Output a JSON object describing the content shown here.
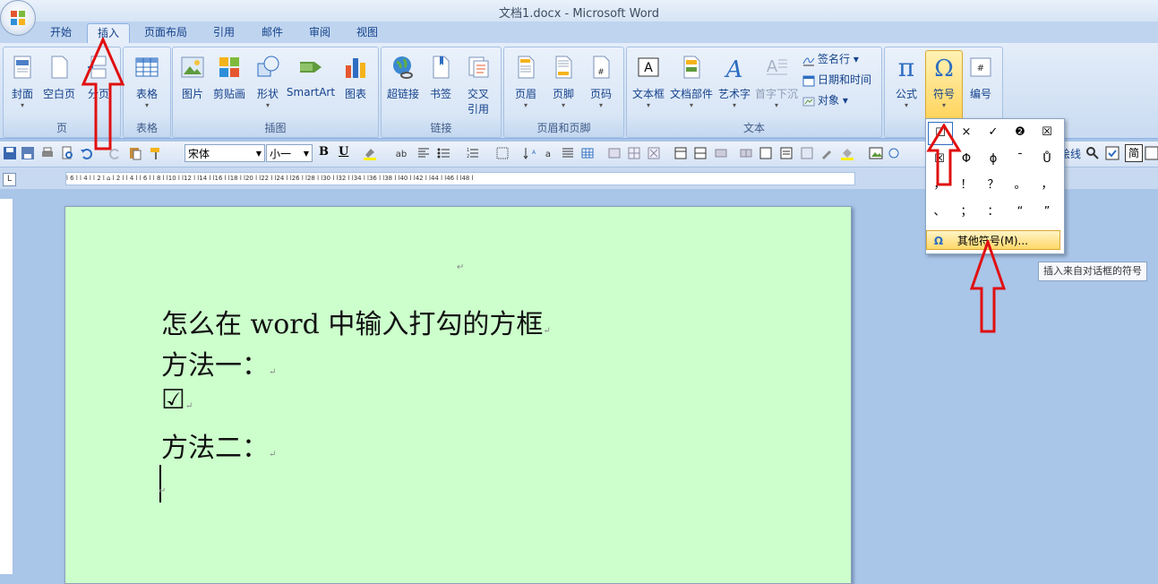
{
  "window": {
    "title": "文档1.docx - Microsoft Word"
  },
  "tabs": [
    "开始",
    "插入",
    "页面布局",
    "引用",
    "邮件",
    "审阅",
    "视图"
  ],
  "active_tab": "插入",
  "ribbon": {
    "groups": {
      "pages": {
        "name": "页",
        "buttons": [
          "封面",
          "空白页",
          "分页"
        ]
      },
      "tables": {
        "name": "表格",
        "buttons": [
          "表格"
        ]
      },
      "illustrations": {
        "name": "插图",
        "buttons": [
          "图片",
          "剪贴画",
          "形状",
          "SmartArt",
          "图表"
        ]
      },
      "links": {
        "name": "链接",
        "buttons": [
          "超链接",
          "书签",
          "交叉",
          "引用"
        ]
      },
      "header_footer": {
        "name": "页眉和页脚",
        "buttons": [
          "页眉",
          "页脚",
          "页码"
        ]
      },
      "text": {
        "name": "文本",
        "buttons": [
          "文本框",
          "文档部件",
          "艺术字",
          "首字下沉"
        ],
        "small": [
          "签名行",
          "日期和时间",
          "对象"
        ]
      },
      "symbols": {
        "buttons": [
          "公式",
          "符号",
          "编号"
        ]
      }
    }
  },
  "toolbar": {
    "font": "宋体",
    "size": "小一",
    "bold": "B",
    "underline": "U",
    "right_text": "绘线",
    "right_char": "简"
  },
  "ruler": {
    "marks": "l 6 l  l 4 l  l 2 l  ⌂  l 2 l  l 4 l  l 6 l  l 8 l  l10 l  l12 l  l14 l  l16 l  l18 l  l20 l  l22 l  l24 l  l26 l  l28 l  l30 l  l32 l  l34 l  l36 l  l38 l  l40 l  l42 l  l44 l  l46 l  l48 l"
  },
  "document": {
    "lines": [
      "怎么在 word 中输入打勾的方框",
      "方法一：",
      "☑",
      "方法二："
    ],
    "paragraph_mark": "↵"
  },
  "symbol_menu": {
    "symbols": [
      "☑",
      "×",
      "✓",
      "❷",
      "☒",
      "☒",
      "Φ",
      "ϕ",
      "¯",
      "Ů",
      "，",
      "！",
      "？",
      "。",
      "，",
      "、",
      "；",
      "：",
      "“",
      "”"
    ],
    "more_label": "其他符号(M)...",
    "more_icon": "Ω"
  },
  "tooltip": "插入来自对话框的符号",
  "colors": {
    "ribbon": "#dbe7f7",
    "page": "#ccffcc",
    "arrow": "#e01010",
    "highlight": "#ffd868"
  }
}
